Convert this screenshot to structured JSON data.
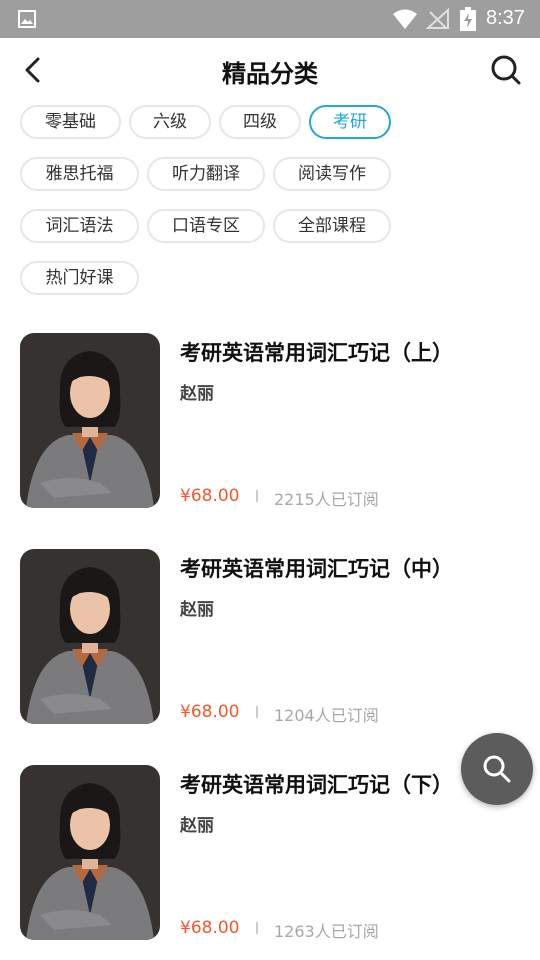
{
  "status_bar": {
    "time": "8:37"
  },
  "header": {
    "title": "精品分类"
  },
  "categories": [
    {
      "label": "零基础",
      "active": false
    },
    {
      "label": "六级",
      "active": false
    },
    {
      "label": "四级",
      "active": false
    },
    {
      "label": "考研",
      "active": true
    },
    {
      "label": "雅思托福",
      "active": false
    },
    {
      "label": "听力翻译",
      "active": false
    },
    {
      "label": "阅读写作",
      "active": false
    },
    {
      "label": "词汇语法",
      "active": false
    },
    {
      "label": "口语专区",
      "active": false
    },
    {
      "label": "全部课程",
      "active": false
    },
    {
      "label": "热门好课",
      "active": false
    }
  ],
  "courses": [
    {
      "title": "考研英语常用词汇巧记（上）",
      "teacher": "赵丽",
      "price": "¥68.00",
      "subscribers": "2215人已订阅"
    },
    {
      "title": "考研英语常用词汇巧记（中）",
      "teacher": "赵丽",
      "price": "¥68.00",
      "subscribers": "1204人已订阅"
    },
    {
      "title": "考研英语常用词汇巧记（下）",
      "teacher": "赵丽",
      "price": "¥68.00",
      "subscribers": "1263人已订阅"
    }
  ],
  "colors": {
    "accent": "#1ea7e0",
    "price": "#f0592a",
    "status_bar": "#9e9e9e"
  },
  "icons": {
    "back": "back-arrow-icon",
    "search": "search-icon",
    "fab": "search-icon"
  }
}
